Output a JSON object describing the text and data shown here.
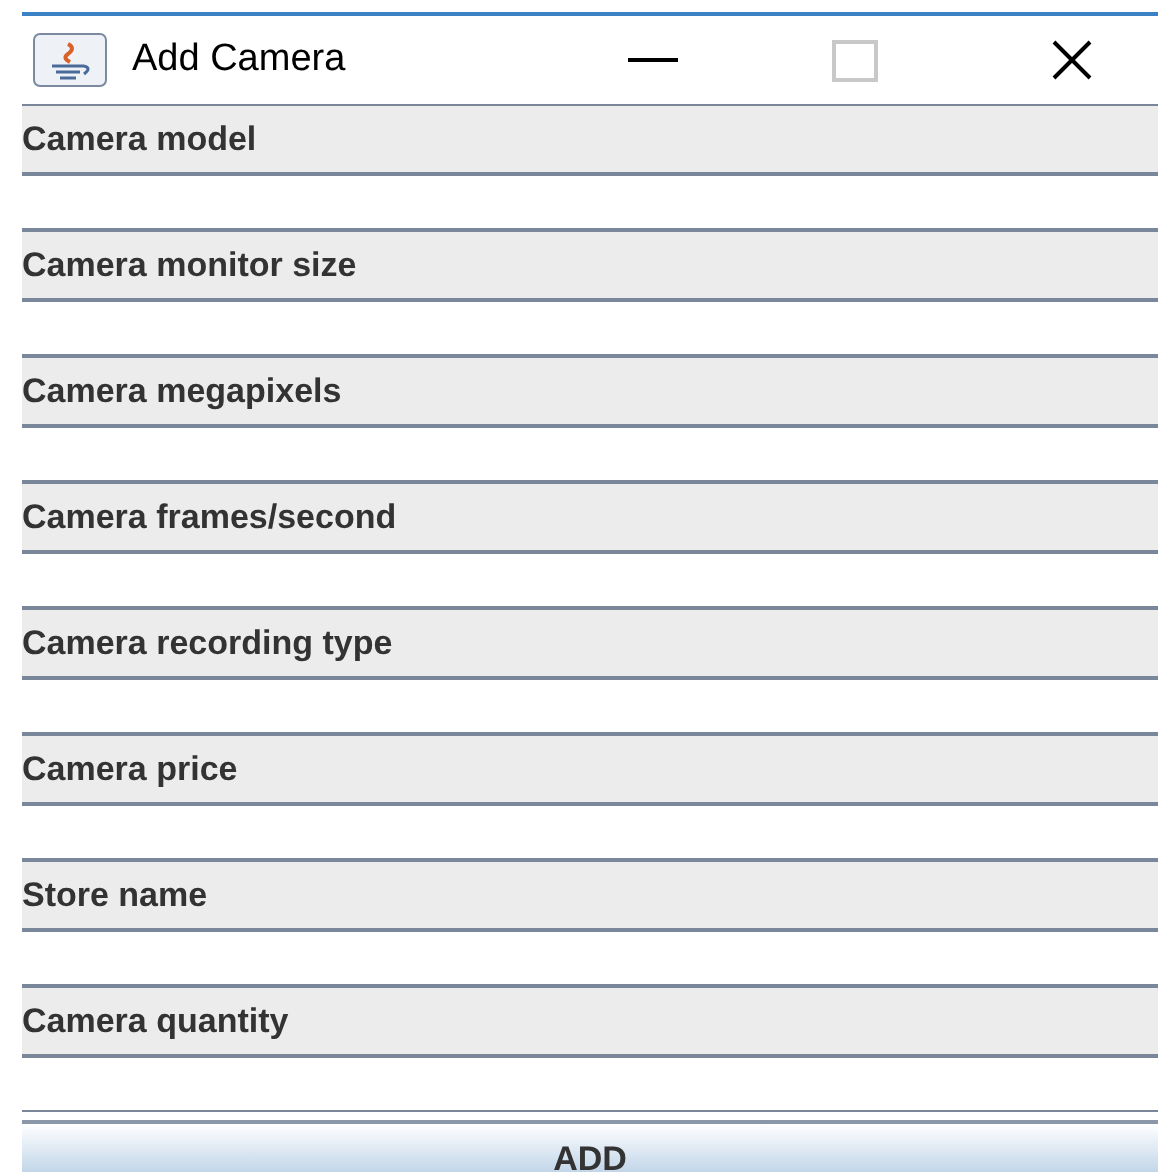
{
  "window": {
    "title": "Add Camera"
  },
  "fields": [
    {
      "label": "Camera model"
    },
    {
      "label": "Camera monitor size"
    },
    {
      "label": "Camera megapixels"
    },
    {
      "label": "Camera frames/second"
    },
    {
      "label": "Camera recording type"
    },
    {
      "label": "Camera price"
    },
    {
      "label": "Store name"
    },
    {
      "label": "Camera quantity"
    }
  ],
  "button": "ADD"
}
